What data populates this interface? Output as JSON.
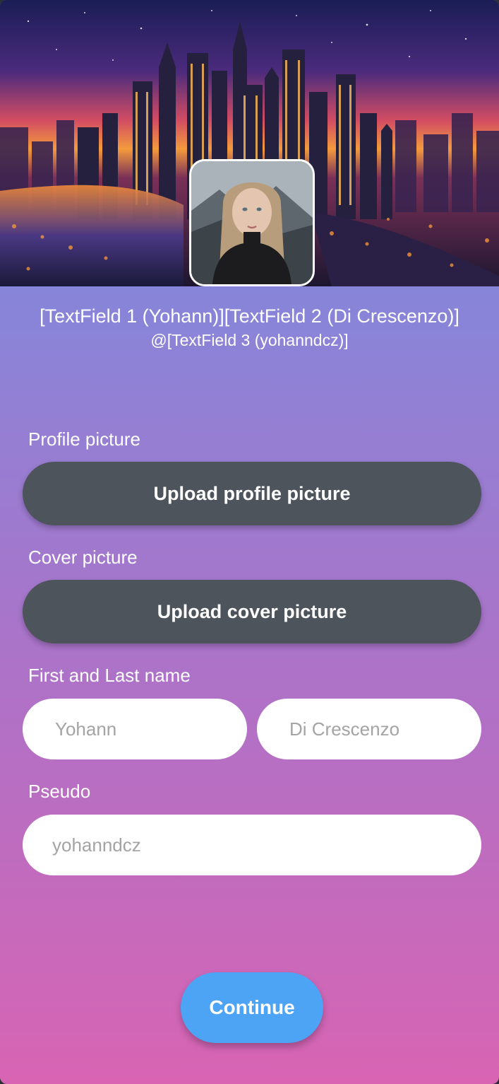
{
  "header": {
    "name_display": "[TextField 1 (Yohann)][TextField 2 (Di Crescenzo)]",
    "handle_display": "@[TextField 3 (yohanndcz)]"
  },
  "profile_picture": {
    "label": "Profile picture",
    "button_label": "Upload profile picture"
  },
  "cover_picture": {
    "label": "Cover picture",
    "button_label": "Upload cover picture"
  },
  "name": {
    "label": "First and Last name",
    "first_placeholder": "Yohann",
    "last_placeholder": "Di Crescenzo"
  },
  "pseudo": {
    "label": "Pseudo",
    "placeholder": "yohanndcz"
  },
  "continue_label": "Continue",
  "colors": {
    "upload_button": "#4d545c",
    "continue_button": "#4da3f4",
    "gradient_top": "#6d8fe0",
    "gradient_bottom": "#d864b3"
  }
}
